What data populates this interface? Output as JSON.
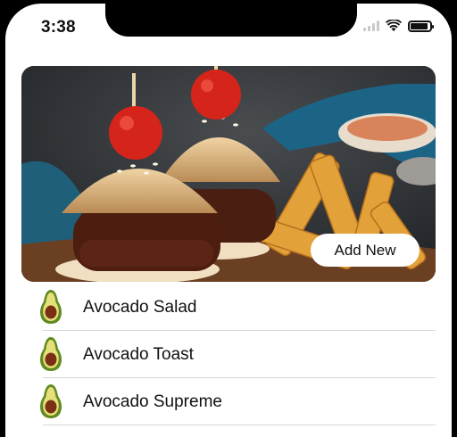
{
  "status_bar": {
    "time": "3:38",
    "icons": [
      "signal-icon",
      "wifi-icon",
      "battery-icon"
    ],
    "battery_level": 0.9
  },
  "hero": {
    "image": "burgers-and-fries-photo",
    "add_button_label": "Add New"
  },
  "list": {
    "items": [
      {
        "label": "Avocado Salad",
        "icon": "avocado-icon"
      },
      {
        "label": "Avocado Toast",
        "icon": "avocado-icon"
      },
      {
        "label": "Avocado Supreme",
        "icon": "avocado-icon"
      }
    ]
  }
}
